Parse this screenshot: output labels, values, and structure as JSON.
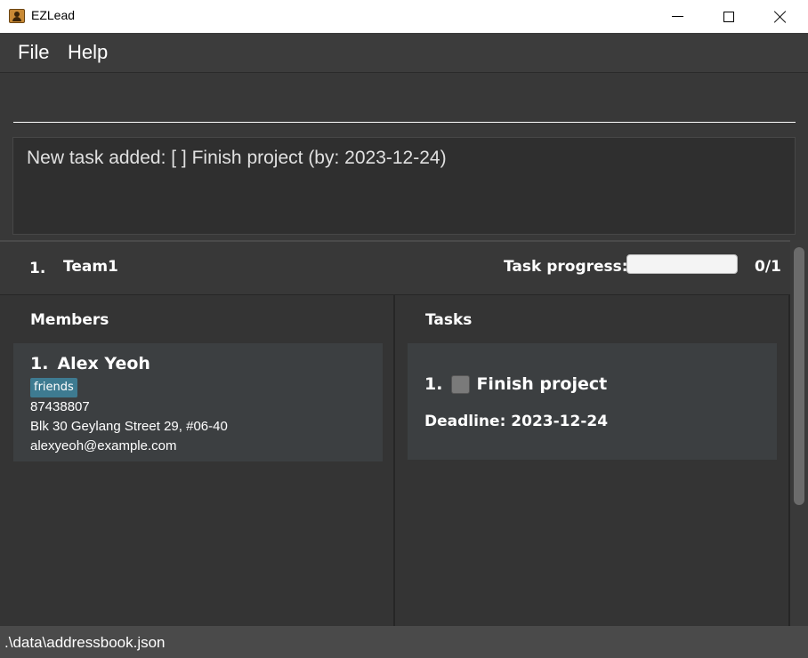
{
  "window": {
    "title": "EZLead",
    "icon": "app-icon"
  },
  "menu": {
    "items": [
      {
        "label": "File"
      },
      {
        "label": "Help"
      }
    ]
  },
  "command": {
    "value": "",
    "placeholder": ""
  },
  "result": {
    "text": "New task added: [ ] Finish project (by: 2023-12-24)"
  },
  "team": {
    "index": "1.",
    "name": "Team1",
    "progress_label": "Task progress:",
    "progress_fraction": 0,
    "progress_count": "0/1",
    "members_title": "Members",
    "tasks_title": "Tasks",
    "members": [
      {
        "index": "1.",
        "name": "Alex Yeoh",
        "tags": [
          "friends"
        ],
        "phone": "87438807",
        "address": "Blk 30 Geylang Street 29, #06-40",
        "email": "alexyeoh@example.com"
      }
    ],
    "tasks": [
      {
        "index": "1.",
        "description": "Finish project",
        "done": false,
        "deadline": "Deadline: 2023-12-24"
      }
    ]
  },
  "status": {
    "path": ".\\data\\addressbook.json"
  },
  "colors": {
    "background": "#3c3c3c",
    "tag": "#3e7b91",
    "card": "#3c3f41"
  }
}
